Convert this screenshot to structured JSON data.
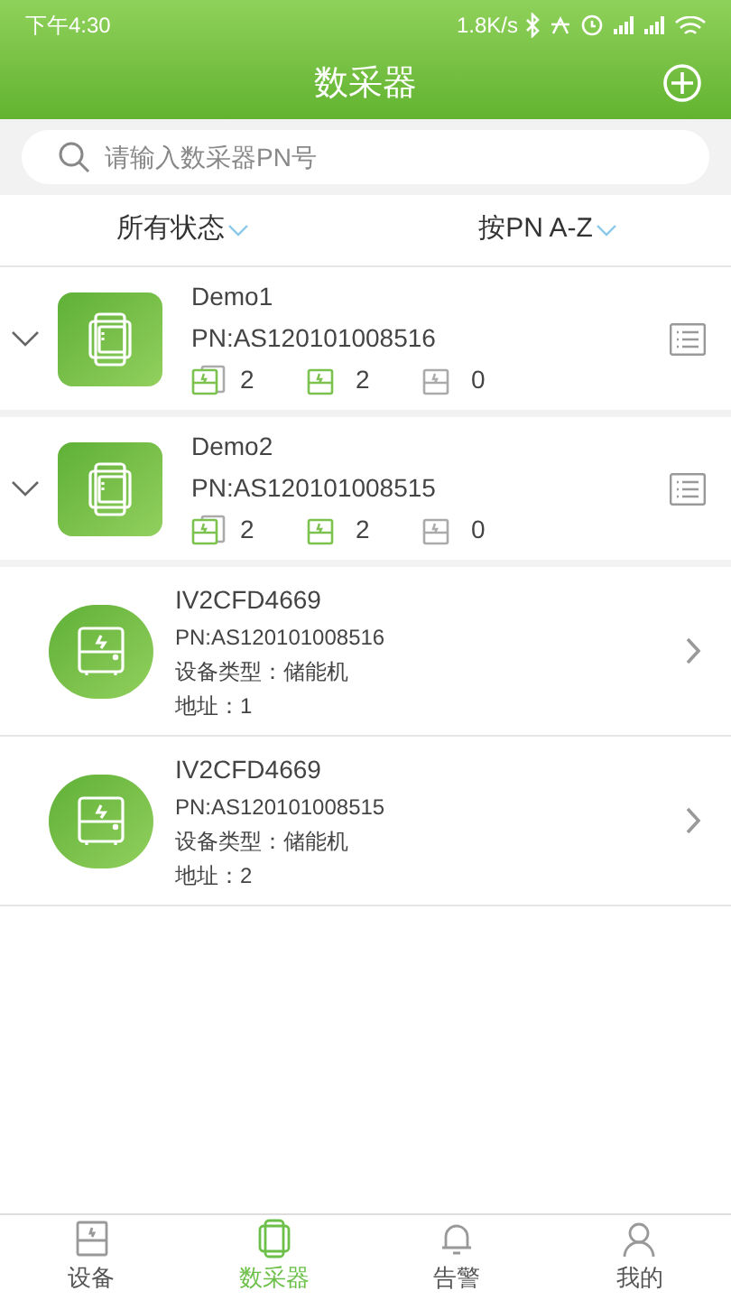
{
  "status_bar": {
    "time": "下午4:30",
    "speed": "1.8K/s"
  },
  "header": {
    "title": "数采器"
  },
  "search": {
    "placeholder": "请输入数采器PN号"
  },
  "filters": [
    {
      "label": "所有状态"
    },
    {
      "label": "按PN A-Z"
    }
  ],
  "collectors": [
    {
      "name": "Demo1",
      "pn": "PN:AS120101008516",
      "counts": [
        {
          "kind": "all",
          "value": "2"
        },
        {
          "kind": "online",
          "value": "2"
        },
        {
          "kind": "offline",
          "value": "0"
        }
      ]
    },
    {
      "name": "Demo2",
      "pn": "PN:AS120101008515",
      "counts": [
        {
          "kind": "all",
          "value": "2"
        },
        {
          "kind": "online",
          "value": "2"
        },
        {
          "kind": "offline",
          "value": "0"
        }
      ]
    }
  ],
  "devices": [
    {
      "name": "IV2CFD4669",
      "pn": "PN:AS120101008516",
      "type": "设备类型：储能机",
      "address": "地址：1"
    },
    {
      "name": "IV2CFD4669",
      "pn": "PN:AS120101008515",
      "type": "设备类型：储能机",
      "address": "地址：2"
    }
  ],
  "tab_bar": [
    {
      "label": "设备",
      "kind": "device",
      "selected": false
    },
    {
      "label": "数采器",
      "kind": "collector",
      "selected": true
    },
    {
      "label": "告警",
      "kind": "alarm",
      "selected": false
    },
    {
      "label": "我的",
      "kind": "me",
      "selected": false
    }
  ]
}
